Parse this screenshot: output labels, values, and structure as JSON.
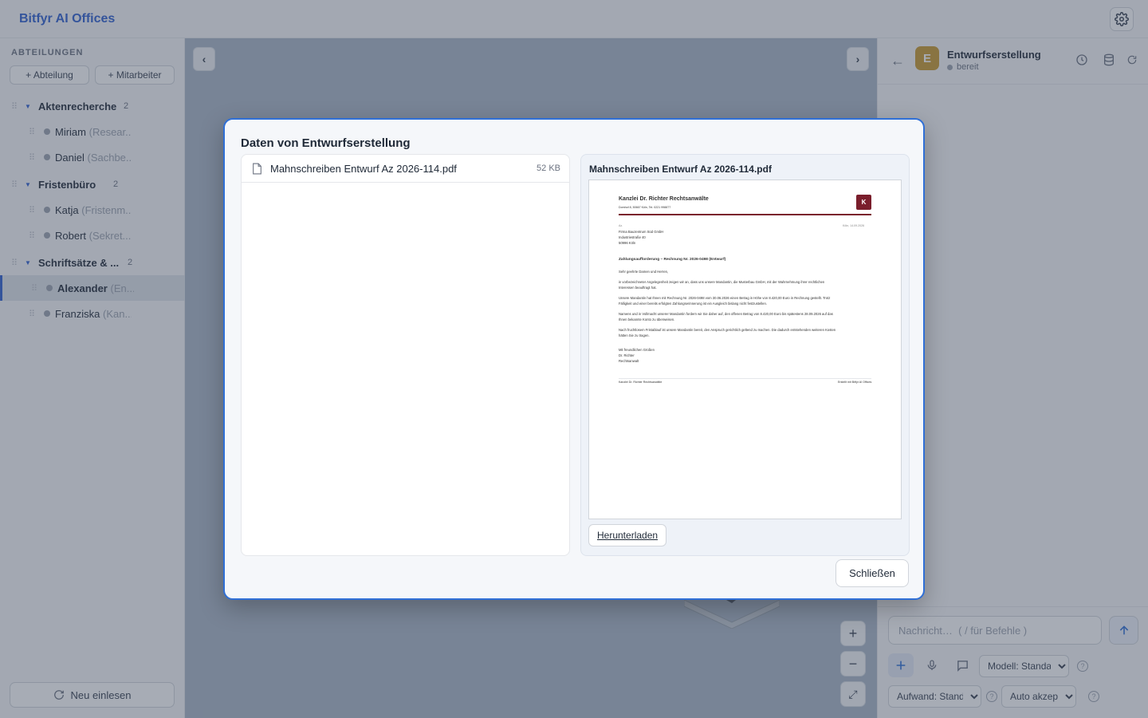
{
  "app": {
    "title": "Bitfyr AI Offices"
  },
  "sidebar": {
    "heading": "ABTEILUNGEN",
    "add_department_label": "+ Abteilung",
    "add_employee_label": "+ Mitarbeiter",
    "departments": [
      {
        "name": "Aktenrecherche",
        "count": "2",
        "employees": [
          {
            "name": "Miriam",
            "role": "(Resear..."
          },
          {
            "name": "Daniel",
            "role": "(Sachbe..."
          }
        ]
      },
      {
        "name": "Fristenbüro",
        "count": "2",
        "employees": [
          {
            "name": "Katja",
            "role": "(Fristenm..."
          },
          {
            "name": "Robert",
            "role": "(Sekret..."
          }
        ]
      },
      {
        "name": "Schriftsätze & ...",
        "count": "2",
        "employees": [
          {
            "name": "Alexander",
            "role": "(En..."
          },
          {
            "name": "Franziska",
            "role": "(Kan..."
          }
        ]
      }
    ],
    "reload_label": "Neu einlesen"
  },
  "canvas": {
    "prev_label": "‹",
    "next_label": "›",
    "zoom_in_label": "+",
    "zoom_out_label": "−",
    "fit_label": "⤢"
  },
  "agent_panel": {
    "back_label": "←",
    "avatar_letter": "E",
    "avatar_color": "#c99a2e",
    "name": "Entwurfserstellung",
    "status": "bereit",
    "message_placeholder": "Nachricht…  ( / für Befehle )",
    "model_select": "Modell: Standard",
    "effort_select": "Aufwand: Standa",
    "accept_select": "Auto akzept."
  },
  "modal": {
    "title": "Daten von Entwurfserstellung",
    "files": [
      {
        "name": "Mahnschreiben Entwurf Az 2026-114.pdf",
        "size": "52 KB"
      }
    ],
    "preview_title": "Mahnschreiben Entwurf Az 2026-114.pdf",
    "download_label": "Herunterladen",
    "close_label": "Schließen",
    "accent_color": "#2f6fd6"
  },
  "letter": {
    "firm": "Kanzlei Dr. Richter Rechtsanwälte",
    "firm_address": "Domhof 8, 50667 Köln, Tel. 0221 998877",
    "logo_letter": "K",
    "ref": "Az.",
    "date": "Köln, 14.09.2026",
    "recipient": [
      "Firma Bauzentrum Süd GmbH",
      "Industriestraße 40",
      "50996 Köln"
    ],
    "subject": "Zahlungsaufforderung – Rechnung Nr. 2026-0498 (Entwurf)",
    "salutation": "Sehr geehrte Damen und Herren,",
    "paragraphs": [
      "in vorbezeichneter Angelegenheit zeigen wir an, dass uns unsere Mandantin, die Musterbau GmbH, mit der Wahrnehmung ihrer rechtlichen",
      "Interessen beauftragt hat.",
      "Unsere Mandantin hat Ihnen mit Rechnung Nr. 2026-0498 vom 30.06.2026 einen Betrag in Höhe von 8.420,00 Euro in Rechnung gestellt. Trotz",
      "Fälligkeit und einer bereits erfolgten Zahlungserinnerung ist ein Ausgleich bislang nicht festzustellen.",
      "Namens und in Vollmacht unserer Mandantin fordern wir Sie daher auf, den offenen Betrag von 8.420,00 Euro bis spätestens 28.09.2026 auf das",
      "Ihnen bekannte Konto zu überweisen.",
      "Nach fruchtlosem Fristablauf ist unsere Mandantin bereit, den Anspruch gerichtlich geltend zu machen. Die dadurch entstehenden weiteren Kosten",
      "hätten Sie zu tragen."
    ],
    "closing": [
      "Mit freundlichen Grüßen",
      "Dr. Richter",
      "Rechtsanwalt"
    ],
    "footer_left": "Kanzlei Dr. Richter Rechtsanwälte",
    "footer_right": "Erstellt mit Bitfyr AI Offices"
  }
}
